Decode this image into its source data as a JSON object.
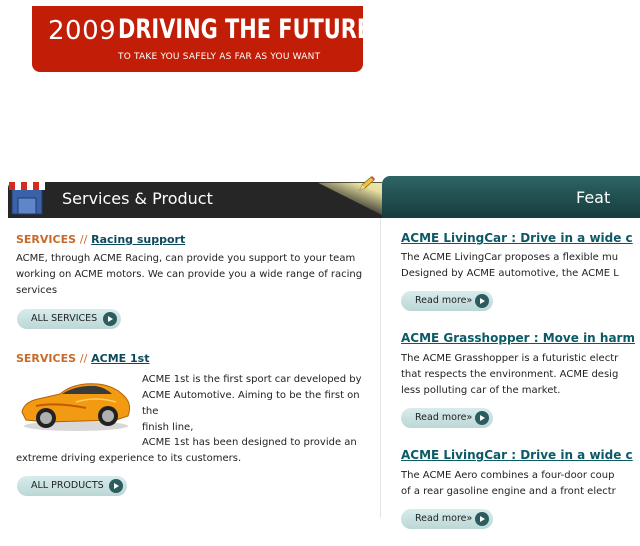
{
  "banner": {
    "year": "2009",
    "headline": "DRIVING THE FUTURE",
    "tagline": "TO TAKE YOU SAFELY AS FAR AS YOU WANT"
  },
  "left_panel": {
    "title": "Services & Product",
    "sections": [
      {
        "category": "SERVICES",
        "separator": "//",
        "link": "Racing support",
        "lines": [
          "ACME, through ACME Racing, can provide you support to your team",
          "working on ACME motors. We can provide you a wide range of racing",
          "services"
        ],
        "button": "ALL SERVICES"
      },
      {
        "category": "SERVICES",
        "separator": "//",
        "link": "ACME 1st",
        "lines_beside_image": [
          "ACME 1st is the first sport car developed by",
          "ACME Automotive. Aiming to be the first on the",
          "finish line,"
        ],
        "lines_after": [
          "ACME 1st has been designed to provide an",
          "extreme driving experience to its customers."
        ],
        "button": "ALL PRODUCTS"
      }
    ]
  },
  "right_panel": {
    "title": "Feat",
    "features": [
      {
        "title": "ACME LivingCar : Drive in a wide c",
        "lines": [
          "The ACME LivingCar proposes a flexible mu",
          "Designed by ACME automotive, the ACME L"
        ],
        "button": "Read more»"
      },
      {
        "title": "ACME Grasshopper : Move in harm",
        "lines": [
          "The ACME Grasshopper is a futuristic electr",
          "that respects the environment. ACME desig",
          "less polluting car of the market."
        ],
        "button": "Read more»"
      },
      {
        "title": "ACME LivingCar : Drive in a wide c",
        "lines": [
          "The ACME Aero combines a four-door coup",
          "of a rear gasoline engine and a front electr"
        ],
        "button": "Read more»"
      }
    ]
  },
  "colors": {
    "banner_red": "#c21d06",
    "left_header": "#262626",
    "right_header": "#1f4c4d",
    "category_orange": "#c86a2a",
    "link_teal": "#0b5a66",
    "button_bg": "#cfe4e4"
  }
}
